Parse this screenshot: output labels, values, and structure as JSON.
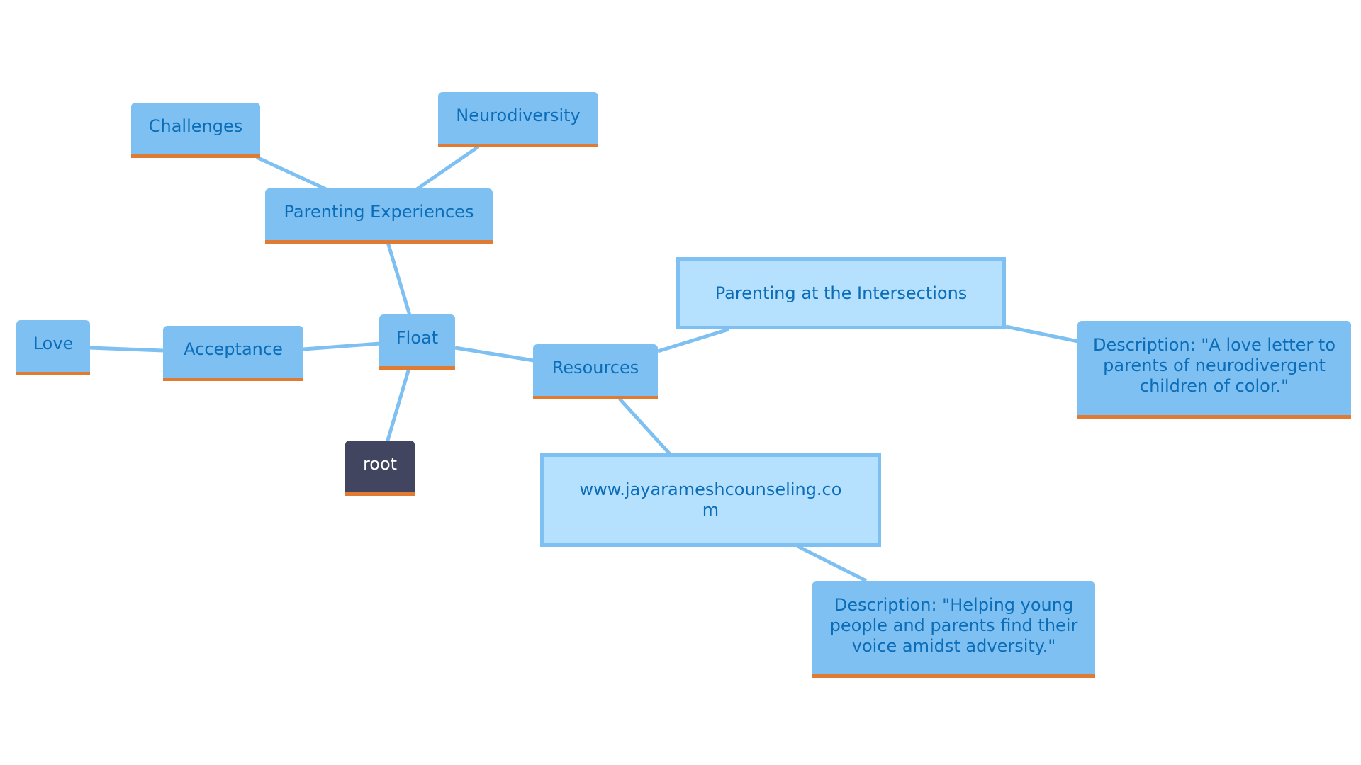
{
  "colors": {
    "node_fill": "#7dc0f1",
    "link_node_fill": "#b5e0fe",
    "node_text": "#0b6db8",
    "accent_underline": "#e07b33",
    "root_fill": "#414560",
    "edge": "#7dc0f1"
  },
  "nodes": {
    "float": "Float",
    "root": "root",
    "acceptance": "Acceptance",
    "love": "Love",
    "parenting_experiences": "Parenting Experiences",
    "challenges": "Challenges",
    "neurodiversity": "Neurodiversity",
    "resources": "Resources",
    "parenting_intersections": "Parenting at the Intersections",
    "description_intersections": "Description: \"A love letter to parents of neurodivergent children of color.\"",
    "website": "www.jayarameshcounseling.com",
    "description_website": "Description: \"Helping young people and parents find their voice amidst adversity.\""
  },
  "edges": [
    [
      "float",
      "root"
    ],
    [
      "float",
      "acceptance"
    ],
    [
      "acceptance",
      "love"
    ],
    [
      "float",
      "parenting_experiences"
    ],
    [
      "parenting_experiences",
      "challenges"
    ],
    [
      "parenting_experiences",
      "neurodiversity"
    ],
    [
      "float",
      "resources"
    ],
    [
      "resources",
      "parenting_intersections"
    ],
    [
      "parenting_intersections",
      "description_intersections"
    ],
    [
      "resources",
      "website"
    ],
    [
      "website",
      "description_website"
    ]
  ]
}
